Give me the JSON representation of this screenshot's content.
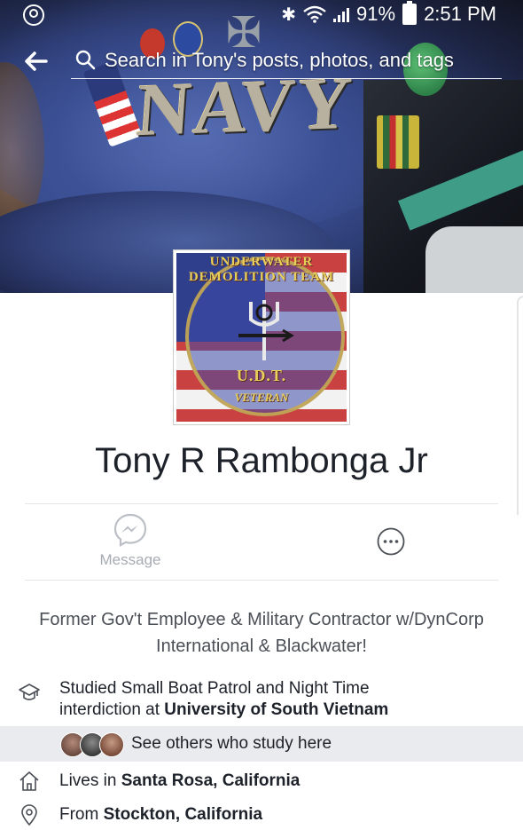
{
  "status_bar": {
    "battery": "91%",
    "time": "2:51 PM"
  },
  "search": {
    "placeholder": "Search in Tony's posts, photos, and tags"
  },
  "cover": {
    "hat_text": "NAVY"
  },
  "profile_picture": {
    "top_text": "UNDERWATER DEMOLITION TEAM",
    "center_text": "U.D.T.",
    "bottom_text": "VETERAN"
  },
  "profile": {
    "name": "Tony R Rambonga Jr",
    "bio": "Former Gov't Employee & Military Contractor w/DynCorp International & Blackwater!"
  },
  "actions": {
    "message_label": "Message"
  },
  "details": {
    "study_prefix": "Studied Small Boat Patrol and Night Time interdiction at ",
    "study_school": "University of South Vietnam",
    "others_label": "See others who study here",
    "lives_prefix": "Lives in ",
    "lives_place": "Santa Rosa, California",
    "from_prefix": "From ",
    "from_place": "Stockton, California"
  },
  "colors": {
    "accent": "#4267b2",
    "text": "#1d2129",
    "muted": "#a7abb2",
    "highlight_row": "#e9ebee"
  }
}
